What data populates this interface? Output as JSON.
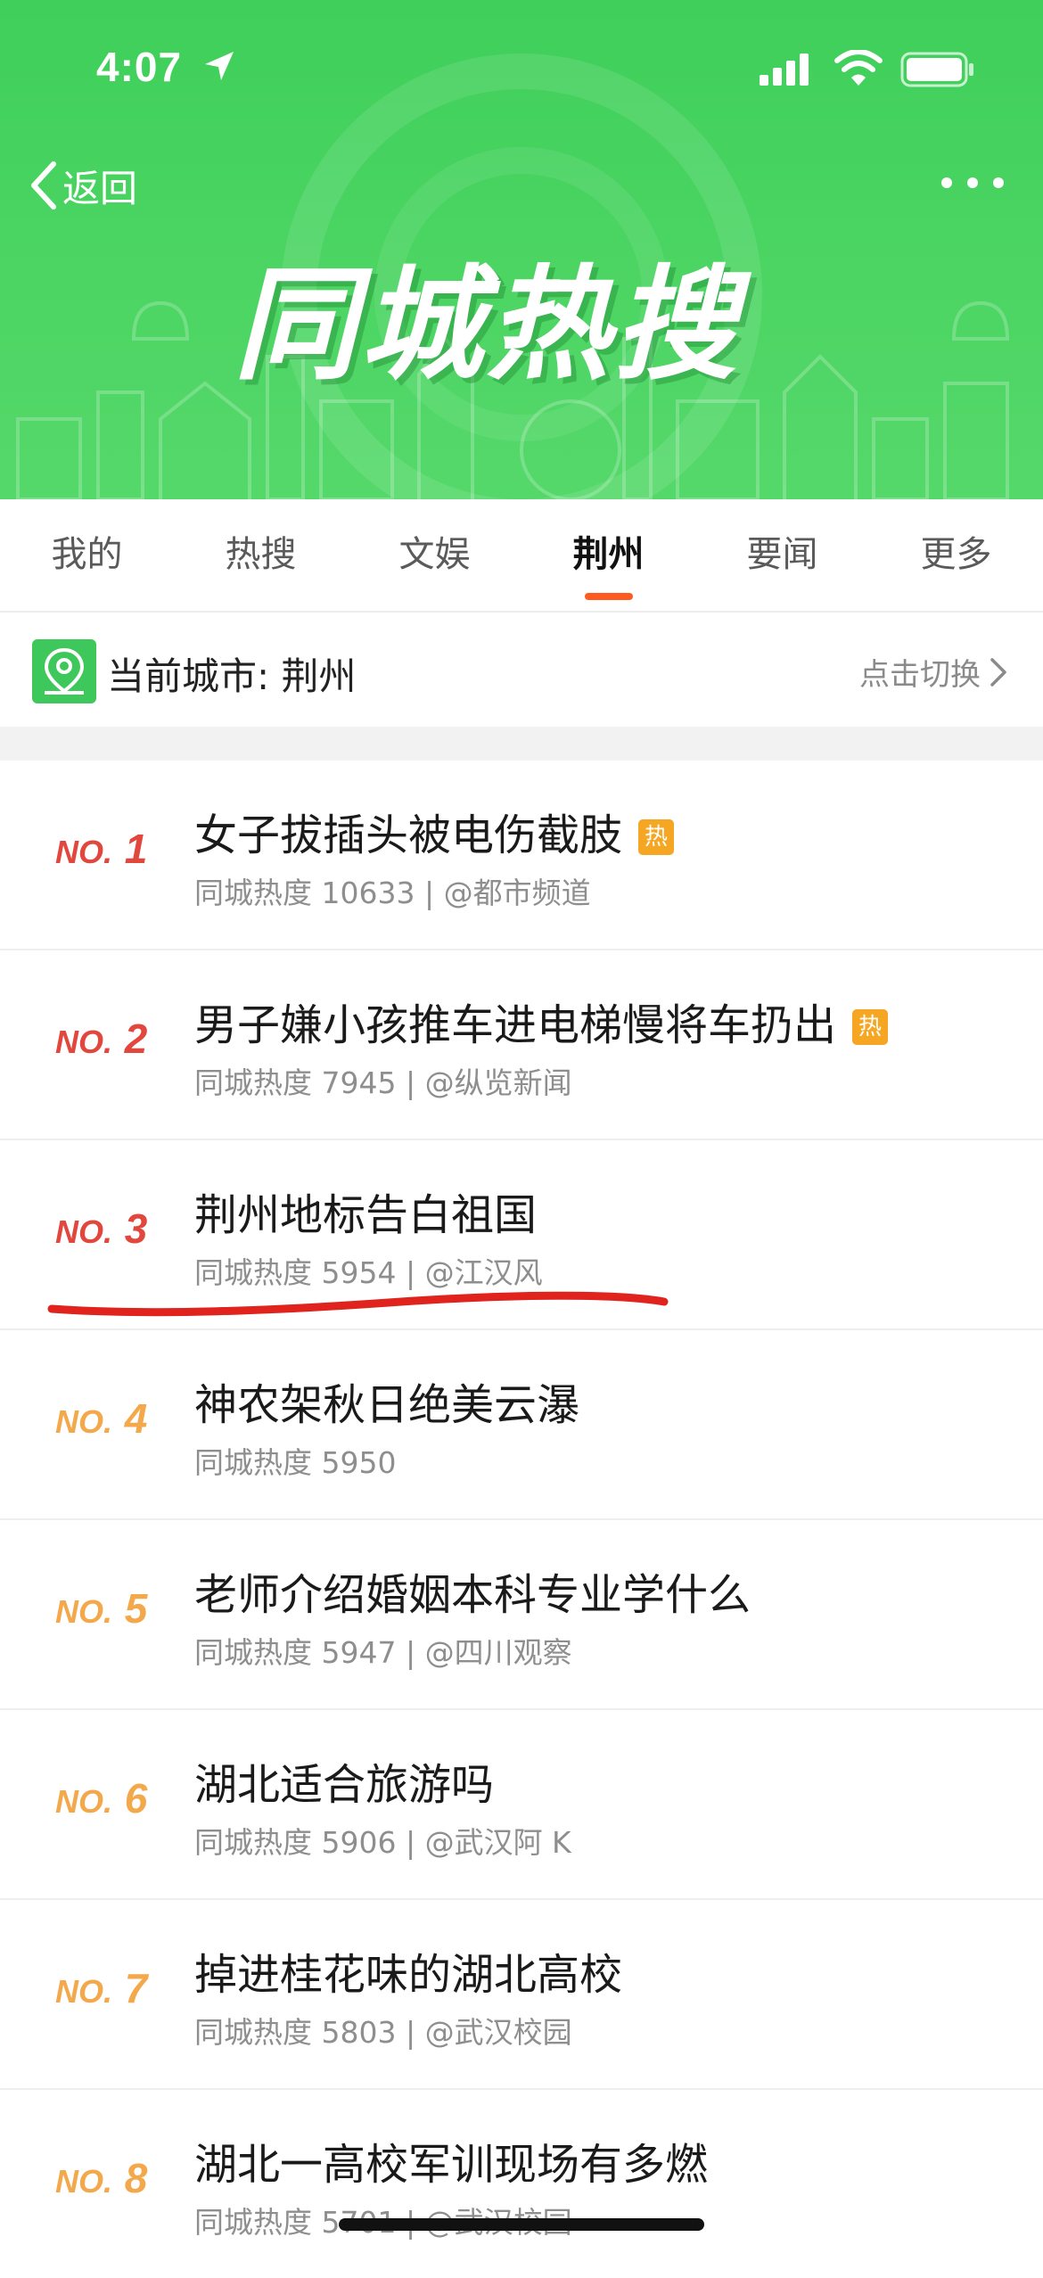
{
  "status_bar": {
    "time": "4:07"
  },
  "nav": {
    "back_label": "返回"
  },
  "hero": {
    "title": "同城热搜"
  },
  "tabs": [
    {
      "label": "我的"
    },
    {
      "label": "热搜"
    },
    {
      "label": "文娱"
    },
    {
      "label": "荆州",
      "active": true
    },
    {
      "label": "要闻"
    },
    {
      "label": "更多"
    }
  ],
  "city": {
    "current_label": "当前城市: 荆州",
    "switch_label": "点击切换"
  },
  "colors": {
    "brand_green": "#4cd563",
    "accent_orange": "#ff5a1f",
    "rank_red": "#e2473d",
    "rank_orange": "#f4a84c",
    "hot_badge": "#f5a623"
  },
  "items": [
    {
      "no": "NO.",
      "rank": "1",
      "title": "女子拔插头被电伤截肢",
      "hot": "热",
      "meta": "同城热度 10633 | @都市频道"
    },
    {
      "no": "NO.",
      "rank": "2",
      "title": "男子嫌小孩推车进电梯慢将车扔出",
      "hot": "热",
      "meta": "同城热度 7945 | @纵览新闻"
    },
    {
      "no": "NO.",
      "rank": "3",
      "title": "荆州地标告白祖国",
      "hot": "",
      "meta": "同城热度 5954 | @江汉风"
    },
    {
      "no": "NO.",
      "rank": "4",
      "title": "神农架秋日绝美云瀑",
      "hot": "",
      "meta": "同城热度 5950"
    },
    {
      "no": "NO.",
      "rank": "5",
      "title": "老师介绍婚姻本科专业学什么",
      "hot": "",
      "meta": "同城热度 5947 | @四川观察"
    },
    {
      "no": "NO.",
      "rank": "6",
      "title": "湖北适合旅游吗",
      "hot": "",
      "meta": "同城热度 5906 | @武汉阿 K"
    },
    {
      "no": "NO.",
      "rank": "7",
      "title": "掉进桂花味的湖北高校",
      "hot": "",
      "meta": "同城热度 5803 | @武汉校园"
    },
    {
      "no": "NO.",
      "rank": "8",
      "title": "湖北一高校军训现场有多燃",
      "hot": "",
      "meta": "同城热度 5701 | @武汉校园"
    }
  ]
}
